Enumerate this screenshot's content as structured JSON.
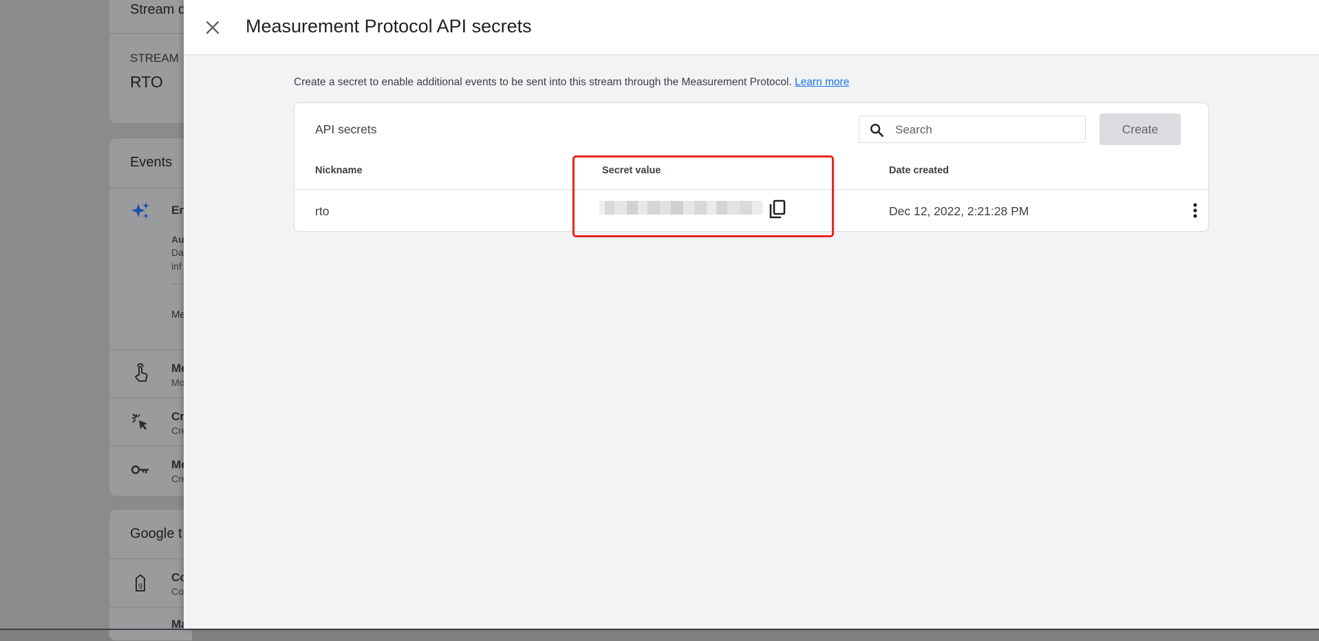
{
  "background": {
    "stream_header": "Stream d",
    "stream_label": "STREAM",
    "stream_name": "RTO",
    "events_title": "Events",
    "enhanced_title": "En",
    "enhanced_lines": [
      "Au",
      "Da",
      "inf"
    ],
    "enhanced_link": "Me",
    "items": [
      {
        "title": "Me",
        "subtitle": "Mo",
        "icon": "touch-icon"
      },
      {
        "title": "Cr",
        "subtitle": "Cre",
        "icon": "click-icon"
      },
      {
        "title": "Me",
        "subtitle": "Cre",
        "icon": "key-icon"
      }
    ],
    "google_tag_title": "Google t",
    "tag_items": [
      {
        "title": "Co",
        "subtitle": "Co",
        "icon": "tag-icon"
      },
      {
        "title": "Ma",
        "icon": "code-icon"
      }
    ]
  },
  "panel": {
    "title": "Measurement Protocol API secrets",
    "description": "Create a secret to enable additional events to be sent into this stream through the Measurement Protocol.",
    "learn_more": "Learn more",
    "card": {
      "title": "API secrets",
      "search_placeholder": "Search",
      "create_label": "Create",
      "columns": [
        "Nickname",
        "Secret value",
        "Date created"
      ],
      "rows": [
        {
          "nickname": "rto",
          "secret_value": "",
          "date_created": "Dec 12, 2022, 2:21:28 PM"
        }
      ]
    }
  },
  "colors": {
    "accent_link": "#1a73e8",
    "highlight_box": "#e8251f",
    "panel_bg": "#f1f3f4",
    "dim_overlay": "#8a8b8d"
  }
}
